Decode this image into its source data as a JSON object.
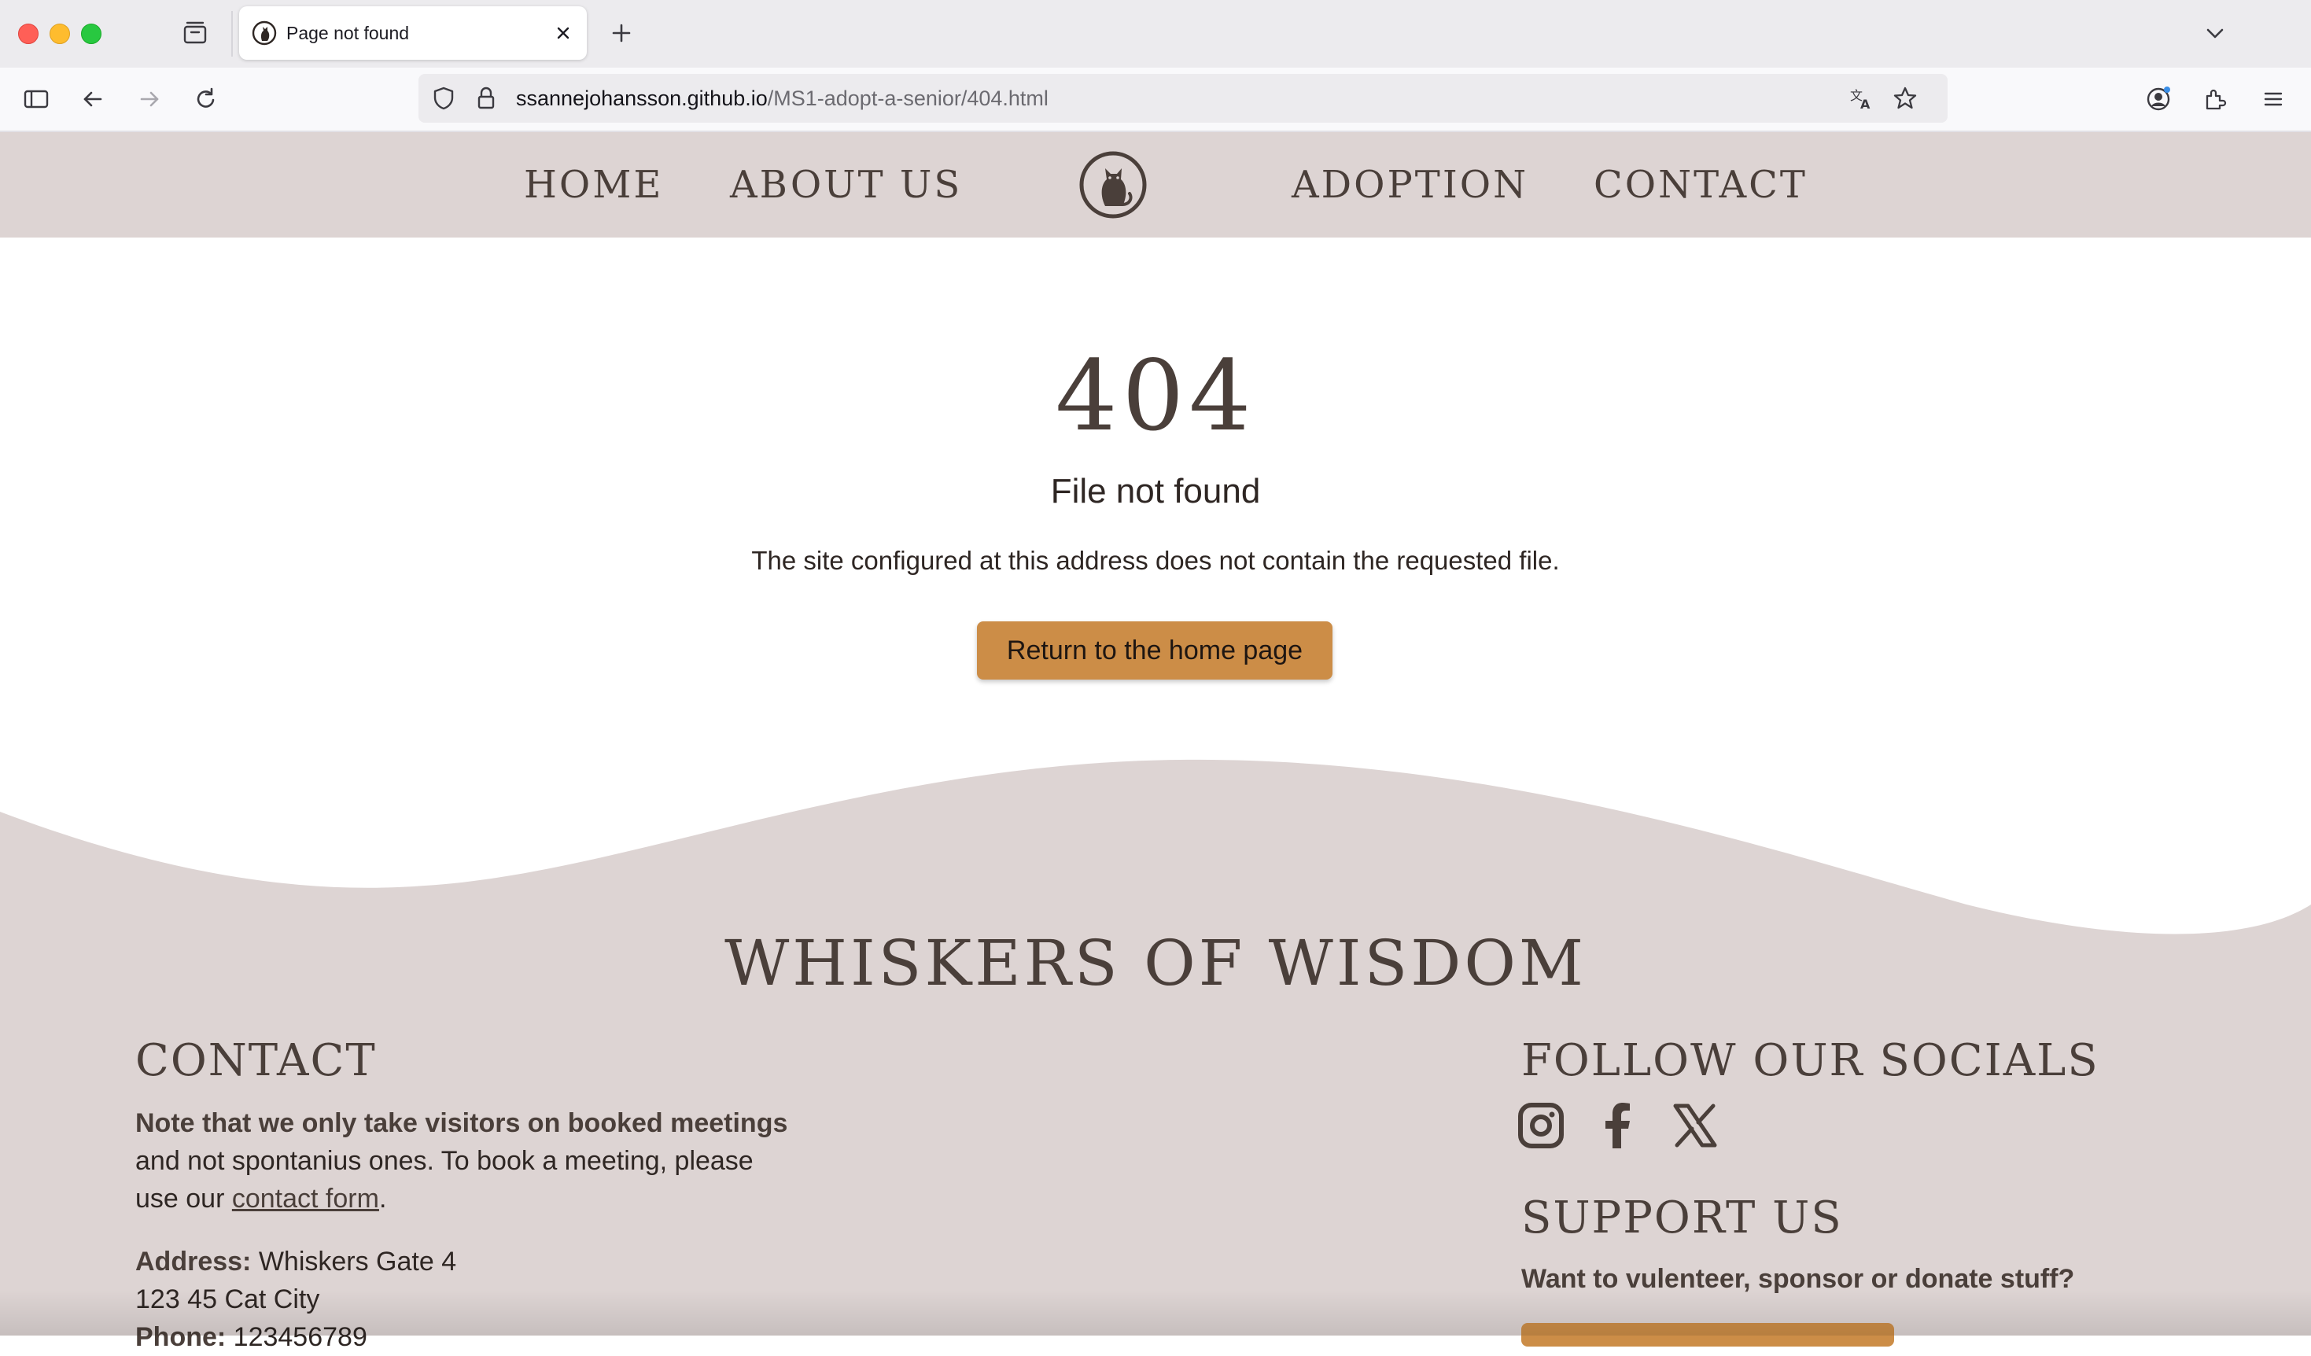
{
  "browser": {
    "tab_title": "Page not found",
    "url_host": "ssannejohansson.github.io",
    "url_path": "/MS1-adopt-a-senior/404.html"
  },
  "site_nav": {
    "home": "HOME",
    "about": "ABOUT US",
    "adoption": "ADOPTION",
    "contact": "CONTACT"
  },
  "error": {
    "code": "404",
    "title": "File not found",
    "description": "The site configured at this address does not contain the requested file.",
    "button": "Return to the home page"
  },
  "footer": {
    "brand": "WHISKERS OF WISDOM",
    "contact": {
      "heading": "CONTACT",
      "note_bold": "Note that we only take visitors on booked meetings",
      "note_rest": "and not spontanius ones. To book a meeting, please",
      "note_line3_prefix": "use our ",
      "contact_link": "contact form",
      "note_line3_suffix": ".",
      "address_label": "Address:",
      "address_line1": "Whiskers Gate 4",
      "address_line2": "123 45 Cat City",
      "phone_label": "Phone:",
      "phone": "123456789"
    },
    "socials": {
      "heading": "FOLLOW OUR SOCIALS",
      "icons": [
        "instagram-icon",
        "facebook-icon",
        "x-icon"
      ]
    },
    "support": {
      "heading": "SUPPORT US",
      "text": "Want to vulenteer, sponsor or donate stuff?"
    }
  },
  "colors": {
    "header_bg": "#ddd4d3",
    "text": "#4a3f3a",
    "accent": "#cc8d47"
  }
}
